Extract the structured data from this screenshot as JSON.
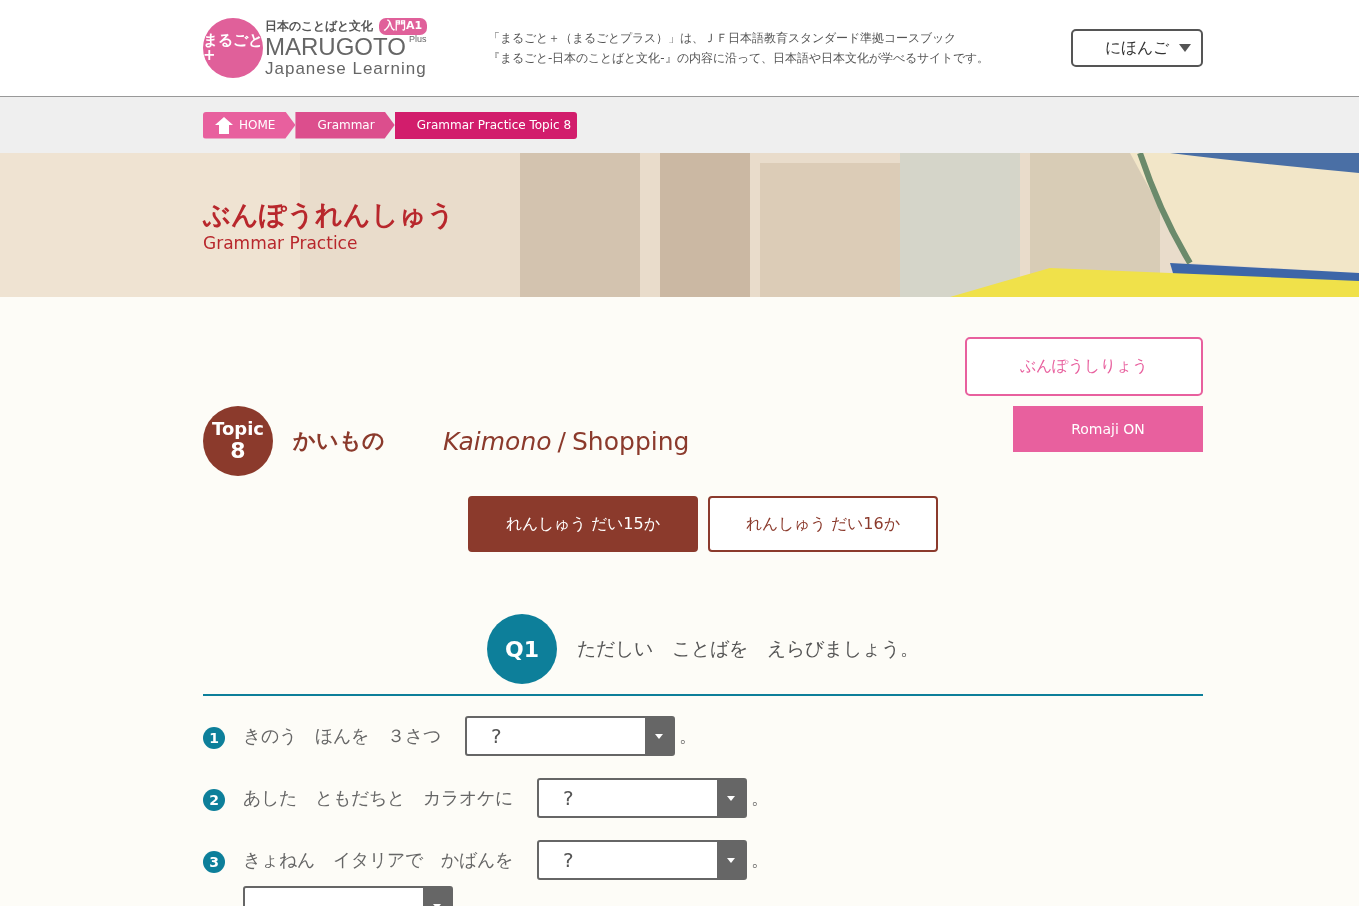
{
  "header": {
    "logo": {
      "mark": "まるごと+",
      "tagline": "日本のことばと文化",
      "level_badge": "入門A1",
      "name": "MARUGOTO",
      "plus": "Plus",
      "subtitle": "Japanese Learning"
    },
    "description": [
      "「まるごと＋（まるごとプラス）」は、ＪＦ日本語教育スタンダード準拠コースブック",
      "『まるごと-日本のことばと文化-』の内容に沿って、日本語や日本文化が学べるサイトです。"
    ],
    "language_select": {
      "value": "にほんご"
    }
  },
  "breadcrumb": [
    {
      "label": "HOME",
      "kind": "home"
    },
    {
      "label": "Grammar",
      "kind": "link"
    },
    {
      "label": "Grammar Practice Topic 8",
      "kind": "current"
    }
  ],
  "banner": {
    "kind": "picture",
    "title": "ぶんぽうれんしゅう",
    "subtitle": "Grammar Practice"
  },
  "actions": {
    "grammar_button": "ぶんぽうしりょう",
    "romaji_button": "Romaji ON"
  },
  "topic": {
    "badge_label": "Topic",
    "badge_number": "8",
    "title_ja": "かいもの",
    "title_romaji": "Kaimono",
    "separator": "/",
    "title_en": "Shopping"
  },
  "lesson_tabs": [
    {
      "label": "れんしゅう だい15か",
      "selected": true
    },
    {
      "label": "れんしゅう だい16か",
      "selected": false
    }
  ],
  "question": {
    "number": "Q1",
    "instruction": "ただしい　ことばを　えらびましょう。"
  },
  "items": [
    {
      "number": "1",
      "parts": [
        {
          "kind": "text",
          "text": "きのう　ほんを　３さつ"
        },
        {
          "kind": "select",
          "value": "?"
        },
        {
          "kind": "text",
          "text": "。"
        }
      ]
    },
    {
      "number": "2",
      "parts": [
        {
          "kind": "text",
          "text": "あした　ともだちと　カラオケに"
        },
        {
          "kind": "select",
          "value": "?"
        },
        {
          "kind": "text",
          "text": "。"
        }
      ]
    },
    {
      "number": "3",
      "parts": [
        {
          "kind": "text",
          "text": "きょねん　イタリアで　かばんを"
        },
        {
          "kind": "select",
          "value": "?"
        },
        {
          "kind": "text",
          "text": "。"
        },
        {
          "kind": "break"
        },
        {
          "kind": "select"
        }
      ]
    }
  ]
}
